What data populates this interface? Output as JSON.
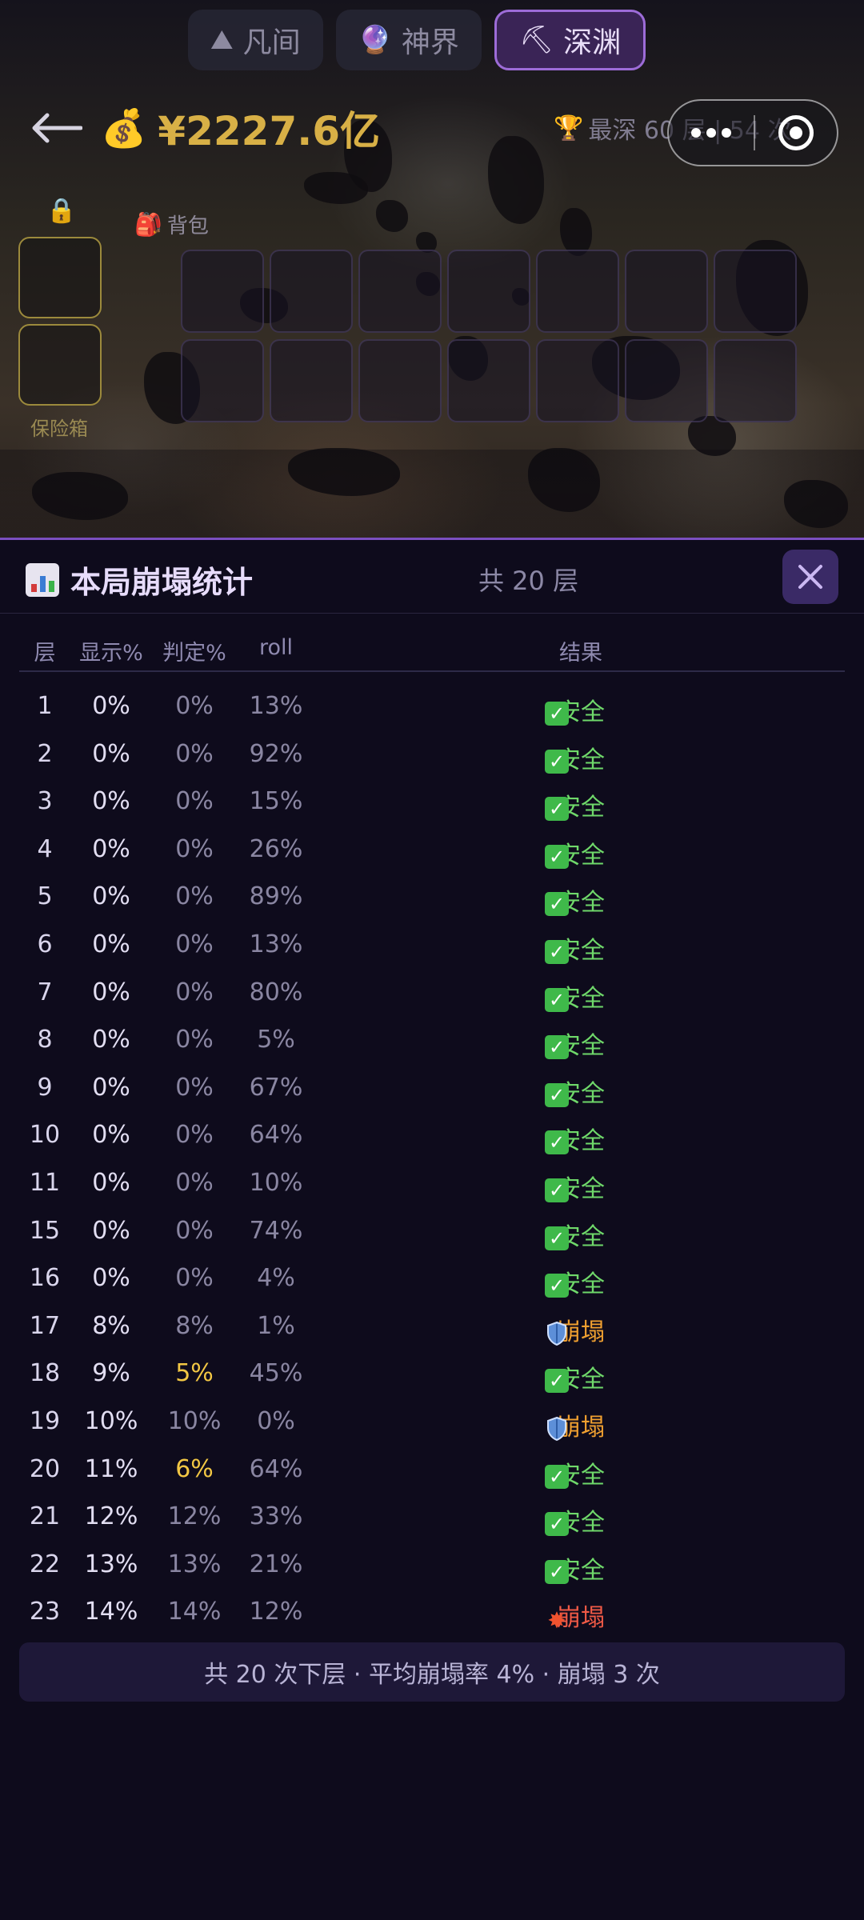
{
  "realm_tabs": [
    {
      "label": "凡间",
      "icon": "mountain-icon",
      "glyph": "⛰"
    },
    {
      "label": "神界",
      "icon": "crystal-ball-icon",
      "glyph": "🔮"
    },
    {
      "label": "深渊",
      "icon": "pickaxe-icon",
      "glyph": "⛏"
    }
  ],
  "active_tab": 2,
  "header": {
    "money_amount": "¥2227.6亿",
    "best_depth": "最深 60 层 | 54 次"
  },
  "safe_box": {
    "label": "保险箱",
    "slots": 2
  },
  "backpack": {
    "label": "背包",
    "slots": 14
  },
  "panel": {
    "title": "本局崩塌统计",
    "total": "共 20 层",
    "columns": {
      "layer": "层",
      "show": "显示%",
      "judge": "判定%",
      "roll": "roll",
      "result": "结果"
    },
    "rows": [
      {
        "layer": "1",
        "show": "0%",
        "judge": "0%",
        "roll": "13%",
        "result": "安全",
        "status": "safe"
      },
      {
        "layer": "2",
        "show": "0%",
        "judge": "0%",
        "roll": "92%",
        "result": "安全",
        "status": "safe"
      },
      {
        "layer": "3",
        "show": "0%",
        "judge": "0%",
        "roll": "15%",
        "result": "安全",
        "status": "safe"
      },
      {
        "layer": "4",
        "show": "0%",
        "judge": "0%",
        "roll": "26%",
        "result": "安全",
        "status": "safe"
      },
      {
        "layer": "5",
        "show": "0%",
        "judge": "0%",
        "roll": "89%",
        "result": "安全",
        "status": "safe"
      },
      {
        "layer": "6",
        "show": "0%",
        "judge": "0%",
        "roll": "13%",
        "result": "安全",
        "status": "safe"
      },
      {
        "layer": "7",
        "show": "0%",
        "judge": "0%",
        "roll": "80%",
        "result": "安全",
        "status": "safe"
      },
      {
        "layer": "8",
        "show": "0%",
        "judge": "0%",
        "roll": "5%",
        "result": "安全",
        "status": "safe"
      },
      {
        "layer": "9",
        "show": "0%",
        "judge": "0%",
        "roll": "67%",
        "result": "安全",
        "status": "safe"
      },
      {
        "layer": "10",
        "show": "0%",
        "judge": "0%",
        "roll": "64%",
        "result": "安全",
        "status": "safe"
      },
      {
        "layer": "11",
        "show": "0%",
        "judge": "0%",
        "roll": "10%",
        "result": "安全",
        "status": "safe"
      },
      {
        "layer": "15",
        "show": "0%",
        "judge": "0%",
        "roll": "74%",
        "result": "安全",
        "status": "safe"
      },
      {
        "layer": "16",
        "show": "0%",
        "judge": "0%",
        "roll": "4%",
        "result": "安全",
        "status": "safe"
      },
      {
        "layer": "17",
        "show": "8%",
        "judge": "8%",
        "roll": "1%",
        "result": "崩塌",
        "status": "shield"
      },
      {
        "layer": "18",
        "show": "9%",
        "judge": "5%",
        "roll": "45%",
        "result": "安全",
        "status": "safe",
        "judge_warn": true
      },
      {
        "layer": "19",
        "show": "10%",
        "judge": "10%",
        "roll": "0%",
        "result": "崩塌",
        "status": "shield"
      },
      {
        "layer": "20",
        "show": "11%",
        "judge": "6%",
        "roll": "64%",
        "result": "安全",
        "status": "safe",
        "judge_warn": true
      },
      {
        "layer": "21",
        "show": "12%",
        "judge": "12%",
        "roll": "33%",
        "result": "安全",
        "status": "safe"
      },
      {
        "layer": "22",
        "show": "13%",
        "judge": "13%",
        "roll": "21%",
        "result": "安全",
        "status": "safe"
      },
      {
        "layer": "23",
        "show": "14%",
        "judge": "14%",
        "roll": "12%",
        "result": "崩塌",
        "status": "boom"
      }
    ],
    "summary": "共 20 次下层 · 平均崩塌率 4% · 崩塌 3 次"
  },
  "colors": {
    "accent": "#7b4fc0",
    "gold": "#d8b046",
    "safe": "#6fd86a",
    "shield_collapse": "#f0a030",
    "boom_collapse": "#f05a46",
    "warn": "#f2c744"
  }
}
